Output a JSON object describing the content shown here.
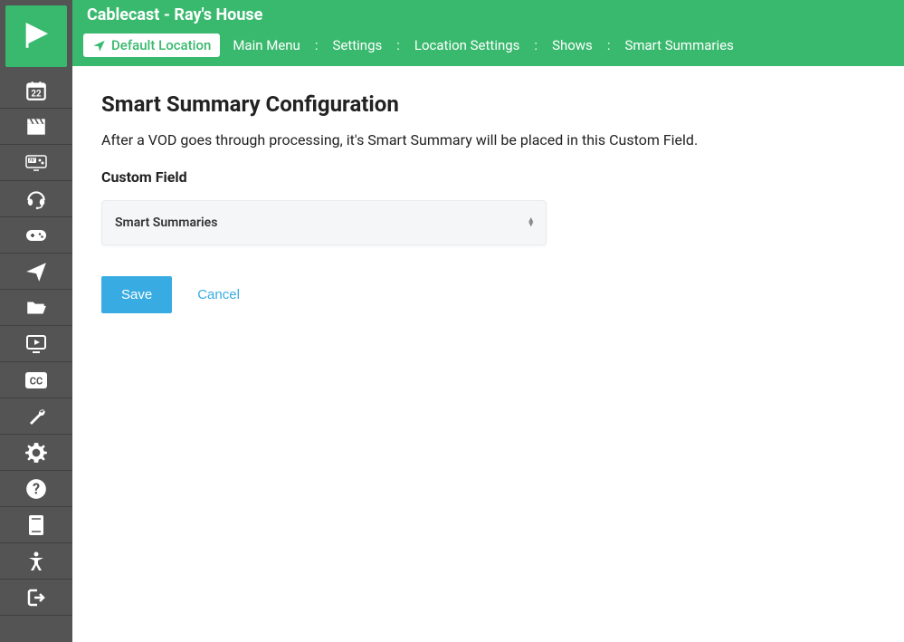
{
  "header": {
    "title": "Cablecast - Ray's House",
    "location_label": "Default Location"
  },
  "breadcrumb": {
    "items": [
      "Main Menu",
      "Settings",
      "Location Settings",
      "Shows",
      "Smart Summaries"
    ]
  },
  "page": {
    "title": "Smart Summary Configuration",
    "description": "After a VOD goes through processing, it's Smart Summary will be placed in this Custom Field.",
    "field_label": "Custom Field",
    "select_value": "Smart Summaries"
  },
  "actions": {
    "save": "Save",
    "cancel": "Cancel"
  },
  "sidebar": {
    "calendar_day": "22"
  }
}
